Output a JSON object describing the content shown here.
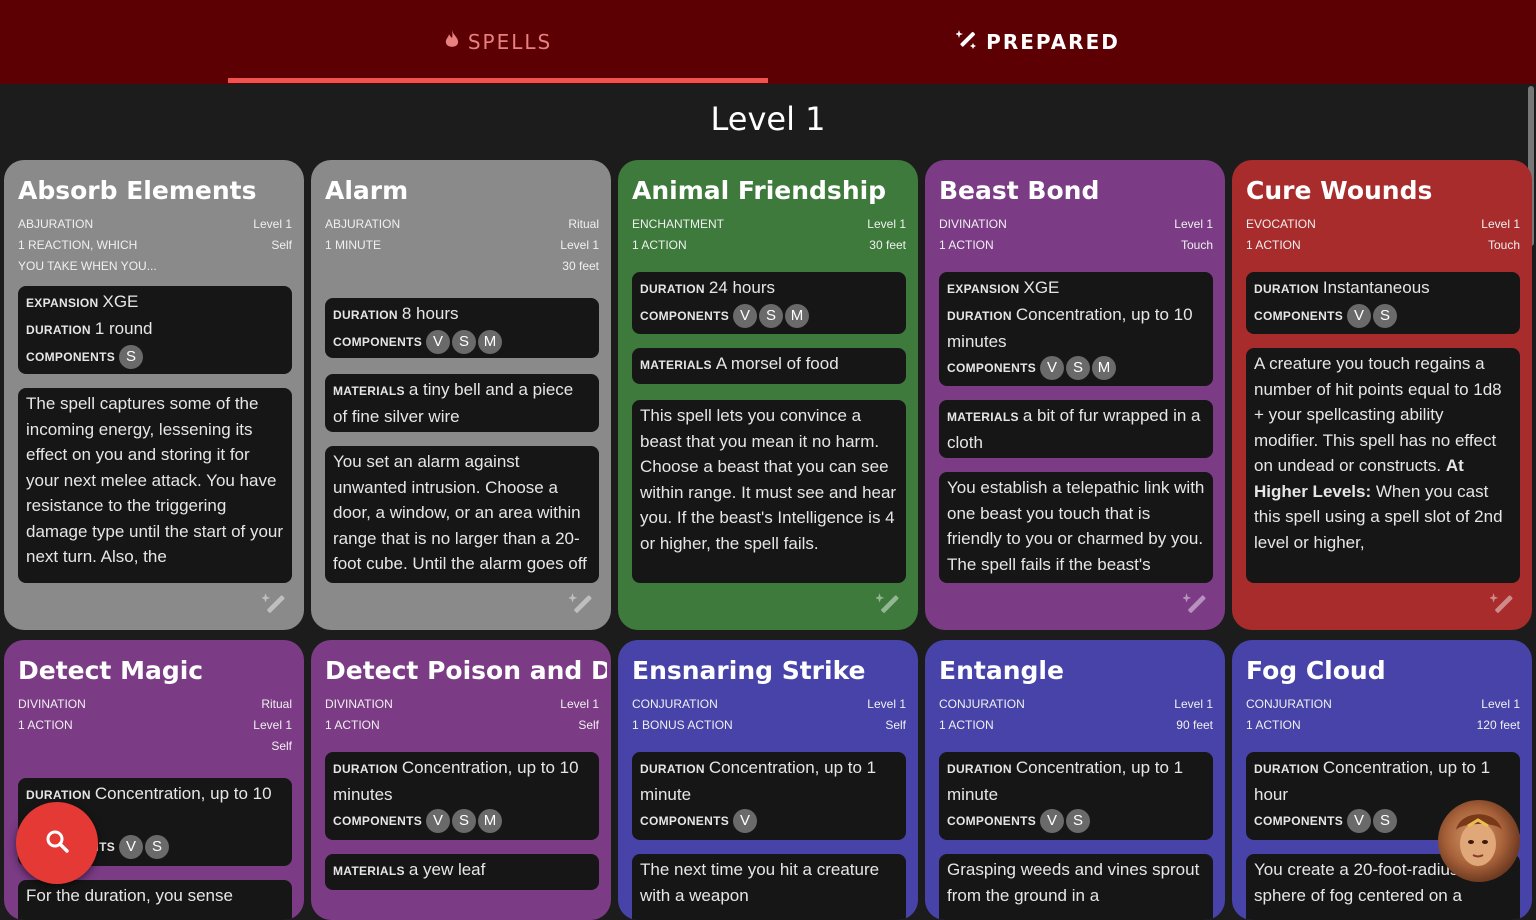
{
  "tabs": {
    "spells_label": "SPELLS",
    "prepared_label": "PREPARED"
  },
  "level_heading": "Level 1",
  "labels": {
    "expansion": "EXPANSION",
    "duration": "DURATION",
    "components": "COMPONENTS",
    "materials": "MATERIALS"
  },
  "cards_row1": [
    {
      "title": "Absorb Elements",
      "school": "ABJURATION",
      "casting": [
        "1 REACTION, WHICH",
        "YOU TAKE WHEN YOU..."
      ],
      "right": [
        "Level 1",
        "Self"
      ],
      "expansion": "XGE",
      "duration": "1 round",
      "components": [
        "S"
      ],
      "description": "The spell captures some of the incoming energy, lessening its effect on you and storing it for your next melee attack. You have resistance to the triggering damage type until the start of your next turn. Also, the"
    },
    {
      "title": "Alarm",
      "school": "ABJURATION",
      "casting": [
        "1 MINUTE"
      ],
      "right": [
        "Ritual",
        "Level 1",
        "30 feet"
      ],
      "duration": "8 hours",
      "components": [
        "V",
        "S",
        "M"
      ],
      "materials": "a tiny bell and a piece of fine silver wire",
      "description": "You set an alarm against unwanted intrusion. Choose a door, a window, or an area within range that is no larger than a 20-foot cube. Until the alarm goes off"
    },
    {
      "title": "Animal Friendship",
      "school": "ENCHANTMENT",
      "casting": [
        "1 ACTION"
      ],
      "right": [
        "Level 1",
        "30 feet"
      ],
      "duration": "24 hours",
      "components": [
        "V",
        "S",
        "M"
      ],
      "materials": "A morsel of food",
      "description": "This spell lets you convince a beast that you mean it no harm. Choose a beast that you can see within range. It must see and hear you. If the beast's Intelligence is 4 or higher, the spell fails."
    },
    {
      "title": "Beast Bond",
      "school": "DIVINATION",
      "casting": [
        "1 ACTION"
      ],
      "right": [
        "Level 1",
        "Touch"
      ],
      "expansion": "XGE",
      "duration": "Concentration, up to 10 minutes",
      "components": [
        "V",
        "S",
        "M"
      ],
      "materials": "a bit of fur wrapped in a cloth",
      "description": "You establish a telepathic link with one beast you touch that is friendly to you or charmed by you. The spell fails if the beast's"
    },
    {
      "title": "Cure Wounds",
      "school": "EVOCATION",
      "casting": [
        "1 ACTION"
      ],
      "right": [
        "Level 1",
        "Touch"
      ],
      "duration": "Instantaneous",
      "components": [
        "V",
        "S"
      ],
      "description": "A creature you touch regains a number of hit points equal to 1d8 + your spellcasting ability modifier. This spell has no effect on undead or constructs.",
      "higher_label": "At Higher Levels:",
      "higher_text": "When you cast this spell using a spell slot of 2nd level or higher,"
    }
  ],
  "cards_row2": [
    {
      "title": "Detect Magic",
      "school": "DIVINATION",
      "casting": [
        "1 ACTION"
      ],
      "right": [
        "Ritual",
        "Level 1",
        "Self"
      ],
      "duration": "Concentration, up to 10 minutes",
      "components": [
        "V",
        "S"
      ],
      "description": "For the duration, you sense"
    },
    {
      "title": "Detect Poison and Disease",
      "school": "DIVINATION",
      "casting": [
        "1 ACTION"
      ],
      "right": [
        "Level 1",
        "Self"
      ],
      "duration": "Concentration, up to 10 minutes",
      "components": [
        "V",
        "S",
        "M"
      ],
      "materials": "a yew leaf"
    },
    {
      "title": "Ensnaring Strike",
      "school": "CONJURATION",
      "casting": [
        "1 BONUS ACTION"
      ],
      "right": [
        "Level 1",
        "Self"
      ],
      "duration": "Concentration, up to 1 minute",
      "components": [
        "V"
      ],
      "description": "The next time you hit a creature with a weapon"
    },
    {
      "title": "Entangle",
      "school": "CONJURATION",
      "casting": [
        "1 ACTION"
      ],
      "right": [
        "Level 1",
        "90 feet"
      ],
      "duration": "Concentration, up to 1 minute",
      "components": [
        "V",
        "S"
      ],
      "description": "Grasping weeds and vines sprout from the ground in a"
    },
    {
      "title": "Fog Cloud",
      "school": "CONJURATION",
      "casting": [
        "1 ACTION"
      ],
      "right": [
        "Level 1",
        "120 feet"
      ],
      "duration": "Concentration, up to 1 hour",
      "components": [
        "V",
        "S"
      ],
      "description": "You create a 20-foot-radius sphere of fog centered on a"
    }
  ],
  "colors": {
    "top_bar": "#5c0004",
    "tab_indicator": "#ef5350",
    "fab": "#e53935",
    "card_abjuration": "#8a8a8a",
    "card_enchantment": "#3d7a3b",
    "card_divination": "#7b3b85",
    "card_evocation": "#a82c2c",
    "card_conjuration": "#4743a8"
  },
  "icons": {
    "spells_tab": "flame-icon",
    "prepared_tab": "magic-wand-icon",
    "card_prepare": "magic-wand-icon",
    "fab": "search-icon"
  }
}
